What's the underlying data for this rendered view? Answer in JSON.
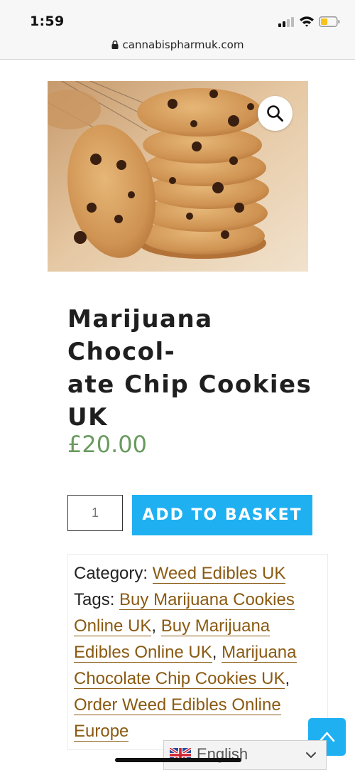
{
  "status_bar": {
    "time": "1:59",
    "icons": [
      "cellular-signal-icon",
      "wifi-icon",
      "battery-low-icon"
    ],
    "battery_color": "#f7c21a"
  },
  "browser": {
    "url": "cannabispharmuk.com",
    "lock_icon": "lock-icon"
  },
  "product": {
    "image_alt": "chocolate chip cookies stack",
    "zoom_icon": "magnifier-icon",
    "title_lines": [
      "Marijuana Chocol-",
      "ate Chip Cookies",
      "UK"
    ],
    "price": "£20.00",
    "price_color": "#6a9a60",
    "quantity": "1",
    "add_button_label": "ADD TO BASKET",
    "accent_color": "#1fb0f2"
  },
  "meta": {
    "category_label": "Category:",
    "category_link": "Weed Edibles UK",
    "tags_label": "Tags:",
    "tags": [
      "Buy Marijuana Cookies Online UK",
      "Buy Marijuana Edibles Online UK",
      "Marijuana Chocolate Chip Cookies UK",
      "Order Weed Edibles Online Europe"
    ],
    "link_color": "#8a5a12"
  },
  "widgets": {
    "back_to_top_icon": "chevron-up-icon",
    "language": "English",
    "language_flag_icon": "uk-flag-icon",
    "language_dropdown_icon": "chevron-down-icon"
  }
}
